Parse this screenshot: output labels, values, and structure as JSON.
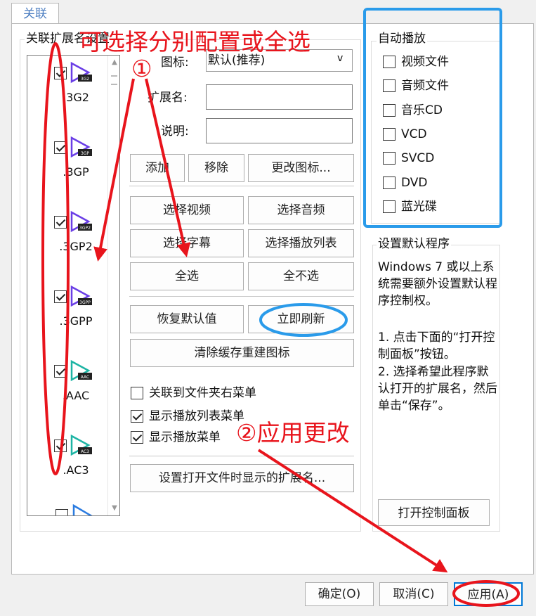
{
  "tab": {
    "label": "关联"
  },
  "assoc_group": {
    "title": "关联扩展名设置",
    "files": [
      {
        "ext": ".3G2",
        "badge": "3G2",
        "checked": true,
        "color": "#6a3ee6"
      },
      {
        "ext": ".3GP",
        "badge": "3GP",
        "checked": true,
        "color": "#6a3ee6"
      },
      {
        "ext": ".3GP2",
        "badge": "3GP2",
        "checked": true,
        "color": "#6a3ee6"
      },
      {
        "ext": ".3GPP",
        "badge": "3GPP",
        "checked": true,
        "color": "#6a3ee6"
      },
      {
        "ext": ".AAC",
        "badge": "AAC",
        "checked": true,
        "color": "#1db4a4"
      },
      {
        "ext": ".AC3",
        "badge": "AC3",
        "checked": true,
        "color": "#1db4a4"
      }
    ],
    "icon_label": "图标:",
    "icon_select_value": "默认(推荐)",
    "ext_label": "扩展名:",
    "desc_label": "说明:",
    "buttons": {
      "add": "添加",
      "remove": "移除",
      "change_icon": "更改图标...",
      "select_video": "选择视频",
      "select_audio": "选择音频",
      "select_subtitle": "选择字幕",
      "select_playlist": "选择播放列表",
      "select_all": "全选",
      "select_none": "全不选",
      "restore_default": "恢复默认值",
      "refresh_now": "立即刷新",
      "clear_cache": "清除缓存重建图标",
      "set_open_ext": "设置打开文件时显示的扩展名..."
    },
    "options": [
      {
        "label": "关联到文件夹右菜单",
        "checked": false
      },
      {
        "label": "显示播放列表菜单",
        "checked": true
      },
      {
        "label": "显示播放菜单",
        "checked": true
      }
    ]
  },
  "autoplay_group": {
    "title": "自动播放",
    "items": [
      {
        "label": "视频文件",
        "checked": false
      },
      {
        "label": "音频文件",
        "checked": false
      },
      {
        "label": "音乐CD",
        "checked": false
      },
      {
        "label": "VCD",
        "checked": false
      },
      {
        "label": "SVCD",
        "checked": false
      },
      {
        "label": "DVD",
        "checked": false
      },
      {
        "label": "蓝光碟",
        "checked": false
      }
    ]
  },
  "default_program_group": {
    "title": "设置默认程序",
    "text1": "Windows 7 或以上系统需要额外设置默认程序控制权。",
    "text2": "1. 点击下面的“打开控制面板”按钮。",
    "text3": "2. 选择希望此程序默认打开的扩展名，然后单击“保存”。",
    "open_control_panel": "打开控制面板"
  },
  "dialog_buttons": {
    "ok": "确定(O)",
    "cancel": "取消(C)",
    "apply": "应用(A)"
  },
  "annotations": {
    "choose_text": "可选择分别配置或全选",
    "step1": "①",
    "step2": "②应用更改",
    "red": "#e8141c",
    "blue": "#2a9bea"
  }
}
